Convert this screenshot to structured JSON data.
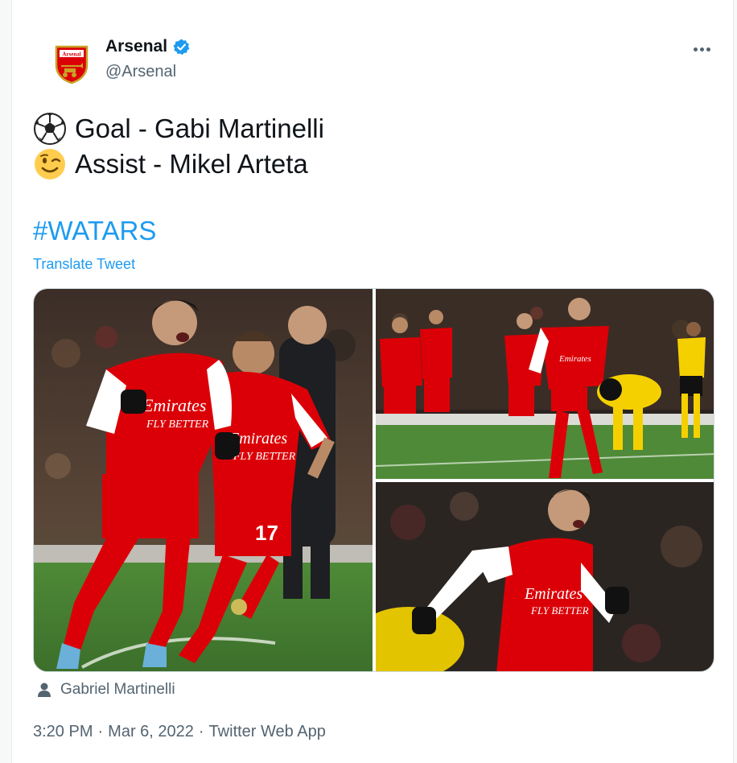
{
  "account": {
    "name": "Arsenal",
    "handle": "@Arsenal",
    "crest_text": "Arsenal",
    "verified_color": "#1d9bf0"
  },
  "tweet": {
    "line1": {
      "icon": "soccer-ball-icon",
      "text": "Goal - Gabi Martinelli"
    },
    "line2": {
      "icon": "winking-face-icon",
      "text": "Assist - Mikel Arteta"
    },
    "hashtag": "#WATARS",
    "translate_label": "Translate Tweet"
  },
  "media": {
    "tagged_icon": "person-icon",
    "tagged_user": "Gabriel Martinelli",
    "photo_1_jersey_numbers": [
      "17"
    ],
    "sponsor_text": "Emirates FLY BETTER"
  },
  "meta": {
    "time": "3:20 PM",
    "separator": "·",
    "date": "Mar 6, 2022",
    "source": "Twitter Web App"
  },
  "colors": {
    "accent": "#1d9bf0",
    "secondary_text": "#536471",
    "arsenal_red": "#db0007"
  }
}
